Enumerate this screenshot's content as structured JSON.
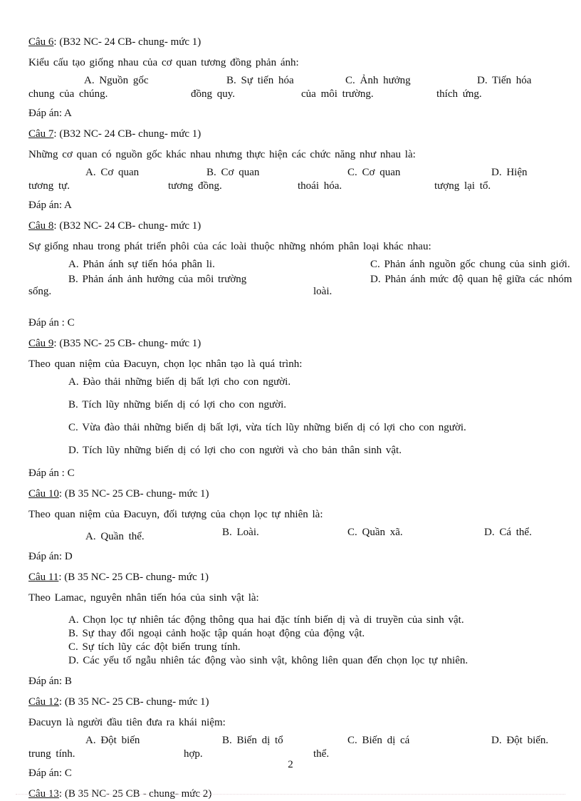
{
  "document": {
    "page_number": "2",
    "language": "vi"
  },
  "questions": [
    {
      "label": "Câu 6",
      "meta": ": (B32 NC-  24 CB- chung-  mức 1)",
      "stem": "Kiểu cấu tạo giống nhau của cơ quan tương đồng phản ánh:",
      "options": [
        {
          "key": "A.",
          "line1": "A. Nguồn gốc",
          "line2": "chung của chúng."
        },
        {
          "key": "B.",
          "line1": "B. Sự tiến hóa",
          "line2": "đồng quy."
        },
        {
          "key": "C.",
          "line1": "C. Ảnh hưởng",
          "line2": "của môi trường."
        },
        {
          "key": "D.",
          "line1": "D.  Tiến  hóa",
          "line2": "thích ứng."
        }
      ],
      "answer": "Đáp án: A"
    },
    {
      "label": "Câu 7",
      "meta": ": (B32 NC- 24 CB- chung-  mức 1)",
      "stem": "Những cơ quan có nguồn gốc khác nhau nhưng thực hiện các chức năng như nhau là:",
      "options": [
        {
          "key": "A.",
          "line1": "A.   Cơ    quan",
          "line2": "tương tự."
        },
        {
          "key": "B.",
          "line1": "B.   Cơ    quan",
          "line2": "tương đồng."
        },
        {
          "key": "C.",
          "line1": "C.   Cơ    quan",
          "line2": "thoái hóa."
        },
        {
          "key": "D.",
          "line1": "D.        Hiện",
          "line2": "tượng lại tổ."
        }
      ],
      "answer": "Đáp án: A"
    },
    {
      "label": "Câu 8",
      "meta": ": (B32 NC- 24 CB- chung-  mức 1)",
      "stem": "Sự giống nhau trong phát triển phôi của các loài thuộc những nhóm phân loại khác nhau:",
      "options_left": [
        "A. Phản ánh sự tiến hóa phân li.",
        "B.  Phản  ánh  ảnh  hưởng  của  môi  trường"
      ],
      "options_right": [
        "C. Phản ánh nguồn gốc chung của sinh giới.",
        "D. Phản ánh mức độ quan hệ giữa các nhóm"
      ],
      "tail_left": "sống.",
      "tail_mid": "loài.",
      "answer": "Đáp án : C"
    },
    {
      "label": "Câu 9",
      "meta": ": (B35 NC- 25 CB- chung-  mức 1)",
      "stem": "Theo quan niệm của Đacuyn, chọn lọc nhân tạo là quá trình:",
      "options": [
        "A. Đào thải những biến dị bất lợi cho con người.",
        "B. Tích lũy những biến dị có lợi cho con người.",
        "C. Vừa đào thải những biến dị bất lợi, vừa tích lũy những biến dị có lợi cho con người.",
        "D. Tích lũy những biến dị có lợi cho con người và cho bản thân sinh vật."
      ],
      "answer": "Đáp án : C"
    },
    {
      "label": "Câu 10",
      "meta": ": (B 35 NC- 25 CB- chung-  mức 1)",
      "stem": "Theo quan niệm của Đacuyn, đối tượng của chọn lọc tự nhiên là:",
      "options": [
        {
          "key": "A.",
          "line1": "A. Quần thể."
        },
        {
          "key": "B.",
          "line1": "B. Loài."
        },
        {
          "key": "C.",
          "line1": "C. Quần xã."
        },
        {
          "key": "D.",
          "line1": "D. Cá thể."
        }
      ],
      "answer": "Đáp án: D"
    },
    {
      "label": "Câu 11",
      "meta": ": (B 35 NC- 25 CB- chung-  mức 1)",
      "stem": "Theo Lamac, nguyên nhân tiến hóa của sinh vật là:",
      "options": [
        "A. Chọn lọc tự nhiên tác động thông qua hai đặc tính biến dị và di truyền của sinh vật.",
        "B. Sự thay đổi ngoại cảnh hoặc tập quán hoạt động của động vật.",
        "C. Sự tích lũy các đột biến trung tính.",
        "D. Các yếu tố ngẫu nhiên tác động vào sinh vật, không liên quan đến chọn lọc tự nhiên."
      ],
      "answer": "Đáp án: B"
    },
    {
      "label": "Câu 12",
      "meta": ": (B 35 NC- 25 CB- chung-  mức 1)",
      "stem": "Đacuyn là người đầu tiên đưa ra khái niệm:",
      "options": [
        {
          "key": "A.",
          "line1": "A.  Đột  biến",
          "line2": "trung tính."
        },
        {
          "key": "B.",
          "line1": "B. Biến dị tổ",
          "line2": "hợp."
        },
        {
          "key": "C.",
          "line1": "C. Biến dị cá",
          "line2": "thể."
        },
        {
          "key": "D.",
          "line1": "D. Đột biến.",
          "line2": ""
        }
      ],
      "answer": "Đáp án: C"
    },
    {
      "label": "Câu 13",
      "meta": ": (B 35 NC-  25 CB - chung-  mức 2)",
      "stem": "",
      "options": [],
      "answer": ""
    }
  ]
}
